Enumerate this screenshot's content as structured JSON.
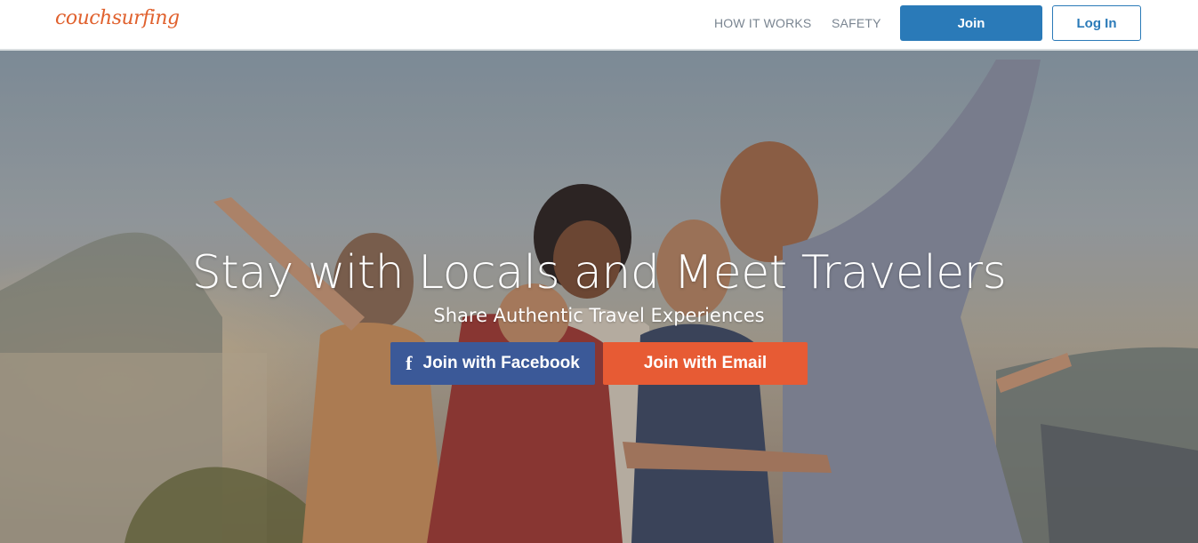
{
  "header": {
    "logo_text": "couchsurfing",
    "nav": {
      "how_it_works": "HOW IT WORKS",
      "safety": "SAFETY"
    },
    "join_label": "Join",
    "login_label": "Log In"
  },
  "hero": {
    "title": "Stay with Locals and Meet Travelers",
    "subtitle": "Share Authentic Travel Experiences",
    "facebook_icon_glyph": "f",
    "facebook_button_label": "Join with Facebook",
    "email_button_label": "Join with Email",
    "background_image": "group-of-friends-posing-by-car-at-seaside-sunset"
  },
  "colors": {
    "brand_orange": "#e0612e",
    "primary_blue": "#2a7ab8",
    "facebook_blue": "#3b5998",
    "email_orange": "#e75b34",
    "nav_gray": "#7a8591"
  }
}
